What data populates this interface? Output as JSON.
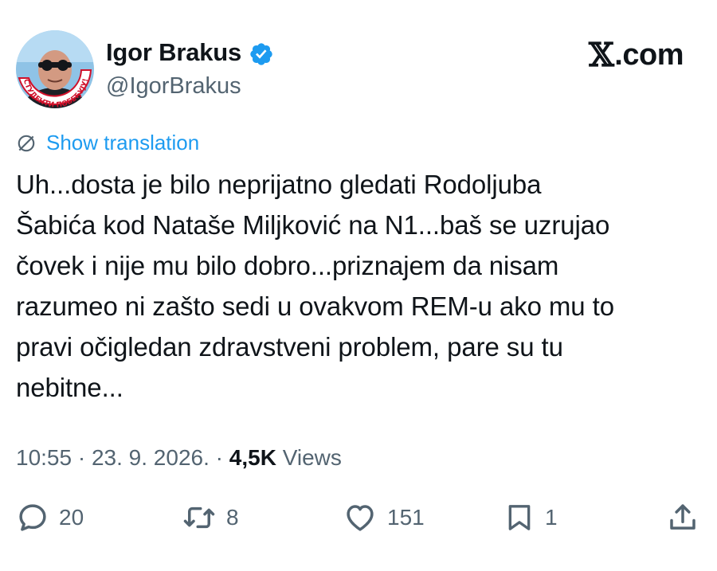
{
  "author": {
    "display_name": "Igor Brakus",
    "handle": "@IgorBrakus",
    "verified": true,
    "avatar_badge_text": "СТУДЕНТИ ПОБЕЂУЈУ!"
  },
  "brand": {
    "name": "X.com",
    "x_mark": "𝕏",
    "suffix": ".com"
  },
  "translation_link": "Show translation",
  "tweet": {
    "text": "Uh...dosta je bilo neprijatno gledati Rodoljuba\nŠabića kod Nataše Miljković na N1...baš se uzrujao\nčovek i nije mu bilo dobro...priznajem da nisam\nrazumeo ni zašto sedi u ovakvom REM-u ako mu to\npravi očigledan zdravstveni problem, pare su tu\nnebitne..."
  },
  "meta": {
    "time": "10:55",
    "separator": "·",
    "date": "23. 9. 2026.",
    "views_count": "4,5K",
    "views_label": "Views"
  },
  "actions": {
    "replies": "20",
    "reposts": "8",
    "likes": "151",
    "bookmarks": "1"
  },
  "colors": {
    "accent": "#1d9bf0",
    "text": "#0f1419",
    "muted": "#536471",
    "background": "#ffffff"
  },
  "icons": {
    "verified": "verified-badge-icon",
    "translate": "globe-icon",
    "reply": "reply-icon",
    "repost": "repost-icon",
    "like": "heart-icon",
    "bookmark": "bookmark-icon",
    "share": "share-icon"
  }
}
